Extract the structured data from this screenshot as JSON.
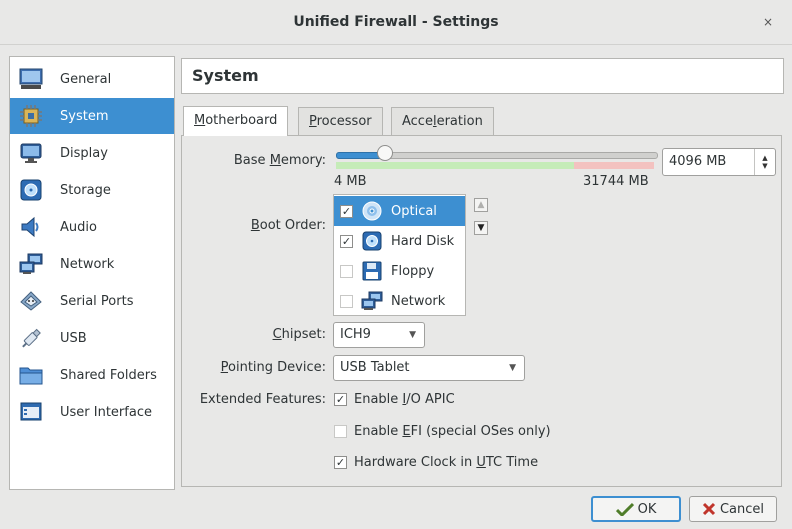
{
  "window": {
    "title": "Unified Firewall - Settings",
    "close_glyph": "×"
  },
  "sidebar": {
    "items": [
      {
        "label": "General",
        "icon": "monitor-icon"
      },
      {
        "label": "System",
        "icon": "chip-icon",
        "selected": true
      },
      {
        "label": "Display",
        "icon": "display-icon"
      },
      {
        "label": "Storage",
        "icon": "disk-icon"
      },
      {
        "label": "Audio",
        "icon": "speaker-icon"
      },
      {
        "label": "Network",
        "icon": "network-icon"
      },
      {
        "label": "Serial Ports",
        "icon": "serial-port-icon"
      },
      {
        "label": "USB",
        "icon": "usb-icon"
      },
      {
        "label": "Shared Folders",
        "icon": "folder-icon"
      },
      {
        "label": "User Interface",
        "icon": "user-interface-icon"
      }
    ]
  },
  "section_title": "System",
  "tabs": [
    {
      "pre": "",
      "u": "M",
      "post": "otherboard",
      "selected": true
    },
    {
      "pre": "",
      "u": "P",
      "post": "rocessor"
    },
    {
      "pre": "Acce",
      "u": "l",
      "post": "eration"
    }
  ],
  "base_memory": {
    "label_pre": "Base ",
    "label_u": "M",
    "label_post": "emory:",
    "min_label": "4 MB",
    "max_label": "31744 MB",
    "value_text": "4096 MB",
    "value": 4096,
    "min": 4,
    "max": 31744,
    "recommended_max": 23808,
    "warn_max": 31744
  },
  "boot_order": {
    "label_pre": "",
    "label_u": "B",
    "label_post": "oot Order:",
    "items": [
      {
        "label": "Optical",
        "checked": true,
        "icon": "optical-disc-icon",
        "selected": true
      },
      {
        "label": "Hard Disk",
        "checked": true,
        "icon": "hard-disk-icon"
      },
      {
        "label": "Floppy",
        "checked": false,
        "icon": "floppy-icon"
      },
      {
        "label": "Network",
        "checked": false,
        "icon": "network-icon"
      }
    ]
  },
  "chipset": {
    "label_pre": "",
    "label_u": "C",
    "label_post": "hipset:",
    "value": "ICH9"
  },
  "pointing": {
    "label_pre": "",
    "label_u": "P",
    "label_post": "ointing Device:",
    "value": "USB Tablet"
  },
  "extended": {
    "label": "Extended Features:",
    "items": [
      {
        "pre": "Enable ",
        "u": "I",
        "post": "/O APIC",
        "checked": true
      },
      {
        "pre": "Enable ",
        "u": "E",
        "post": "FI (special OSes only)",
        "checked": false
      },
      {
        "pre": "Hardware Clock in ",
        "u": "U",
        "post": "TC Time",
        "checked": true
      }
    ]
  },
  "buttons": {
    "ok": "OK",
    "cancel": "Cancel"
  },
  "check_glyph": "✓",
  "colors": {
    "accent": "#3d8fd1",
    "ok_zone": "#c5ecb8",
    "warn_zone": "#f3c2c0"
  }
}
